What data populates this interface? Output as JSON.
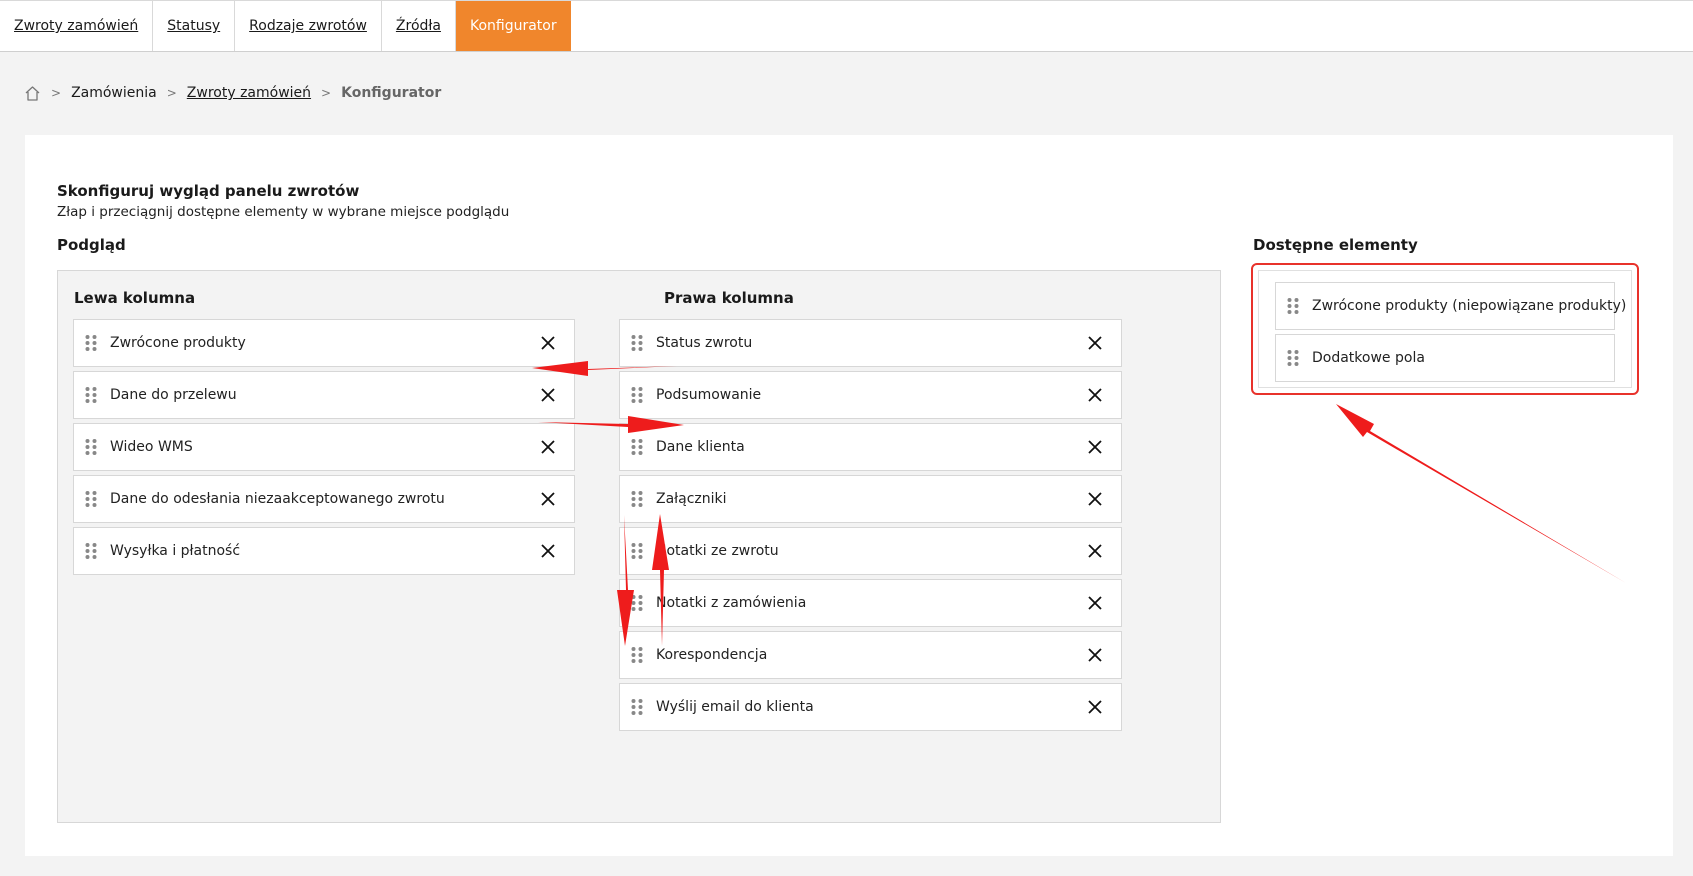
{
  "tabs": [
    {
      "label": "Zwroty zamówień",
      "active": false
    },
    {
      "label": "Statusy",
      "active": false
    },
    {
      "label": "Rodzaje zwrotów",
      "active": false
    },
    {
      "label": "Źródła",
      "active": false
    },
    {
      "label": "Konfigurator",
      "active": true
    }
  ],
  "breadcrumb": {
    "home_icon": "home-icon",
    "items": [
      "Zamówienia",
      "Zwroty zamówień",
      "Konfigurator"
    ]
  },
  "panel": {
    "title": "Skonfiguruj wygląd panelu zwrotów",
    "subtitle": "Złap i przeciągnij dostępne elementy w wybrane miejsce podglądu",
    "preview_label": "Podgląd",
    "available_label": "Dostępne elementy"
  },
  "left_column": {
    "title": "Lewa kolumna",
    "items": [
      "Zwrócone produkty",
      "Dane do przelewu",
      "Wideo WMS",
      "Dane do odesłania niezaakceptowanego zwrotu",
      "Wysyłka i płatność"
    ]
  },
  "right_column": {
    "title": "Prawa kolumna",
    "items": [
      "Status zwrotu",
      "Podsumowanie",
      "Dane klienta",
      "Załączniki",
      "Notatki ze zwrotu",
      "Notatki z zamówienia",
      "Korespondencja",
      "Wyślij email do klienta"
    ]
  },
  "available_items": [
    "Zwrócone produkty (niepowiązane produkty)",
    "Dodatkowe pola"
  ],
  "colors": {
    "accent": "#f0862c",
    "annotation": "#e8322b",
    "background": "#f3f3f3"
  }
}
